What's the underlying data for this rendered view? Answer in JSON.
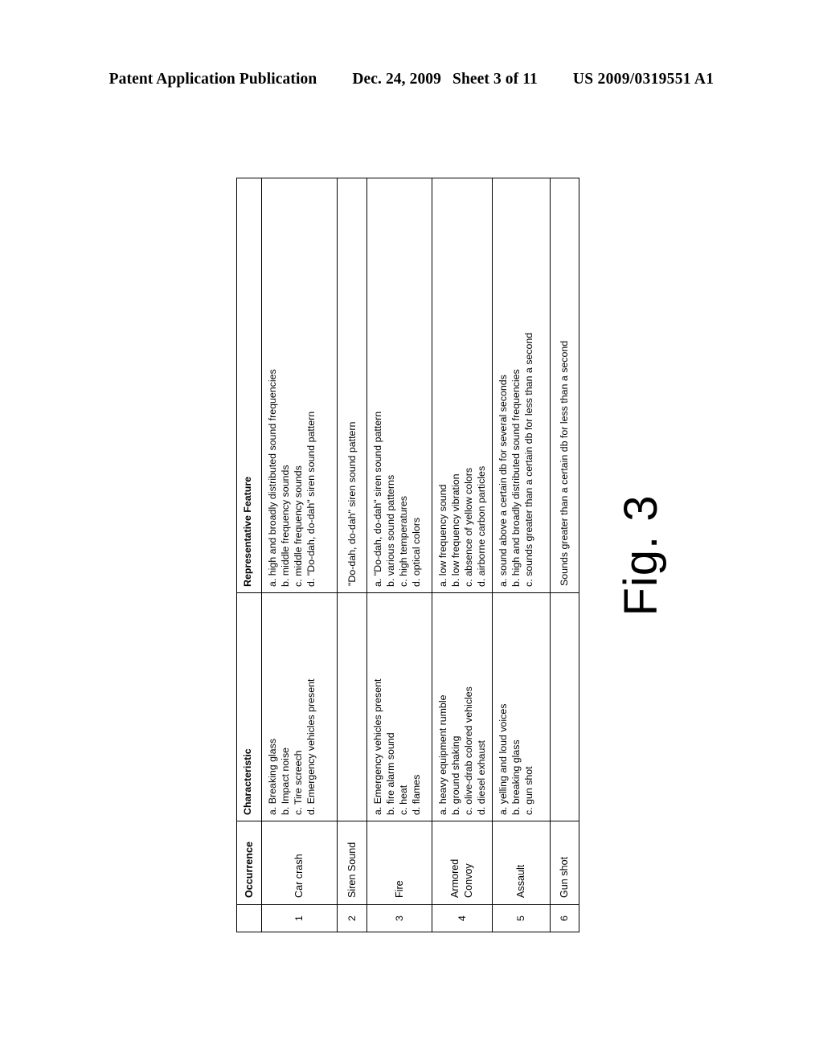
{
  "header": {
    "publication": "Patent Application Publication",
    "date": "Dec. 24, 2009",
    "sheet": "Sheet 3 of 11",
    "number": "US 2009/0319551 A1"
  },
  "figure": {
    "caption": "Fig. 3",
    "table": {
      "columns": [
        {
          "key": "num",
          "label": ""
        },
        {
          "key": "occ",
          "label": "Occurrence"
        },
        {
          "key": "char",
          "label": "Characteristic"
        },
        {
          "key": "feat",
          "label": "Representative Feature"
        }
      ],
      "rows": [
        {
          "num": "1",
          "occurrence": "Car crash",
          "characteristic": "a. Breaking glass\nb. Impact noise\nc. Tire screech\nd. Emergency vehicles present",
          "feature": "a. high and broadly distributed sound frequencies\nb. middle frequency sounds\nc. middle frequency sounds\nd. \"Do-dah, do-dah\" siren sound pattern"
        },
        {
          "num": "2",
          "occurrence": "Siren Sound",
          "characteristic": "",
          "feature": "\"Do-dah, do-dah\" siren sound pattern"
        },
        {
          "num": "3",
          "occurrence": "Fire",
          "characteristic": "a. Emergency vehicles present\nb. fire alarm sound\nc. heat\nd. flames",
          "feature": "a. \"Do-dah, do-dah\" siren sound pattern\nb. various sound patterns\nc. high temperatures\nd. optical colors"
        },
        {
          "num": "4",
          "occurrence": "Armored Convoy",
          "characteristic": "a. heavy equipment rumble\nb. ground shaking\nc. olive-drab colored vehicles\nd. diesel exhaust",
          "feature": "a. low frequency sound\nb. low frequency vibration\nc. absence of yellow colors\nd. airborne carbon particles"
        },
        {
          "num": "5",
          "occurrence": "Assault",
          "characteristic": "a. yelling and loud voices\nb. breaking glass\nc. gun shot",
          "feature": "a. sound above a certain db for several seconds\nb. high and broadly distributed sound frequencies\nc. sounds greater than a certain db for less than a second"
        },
        {
          "num": "6",
          "occurrence": "Gun shot",
          "characteristic": "",
          "feature": "Sounds greater than a certain db for less than a second"
        }
      ]
    }
  }
}
